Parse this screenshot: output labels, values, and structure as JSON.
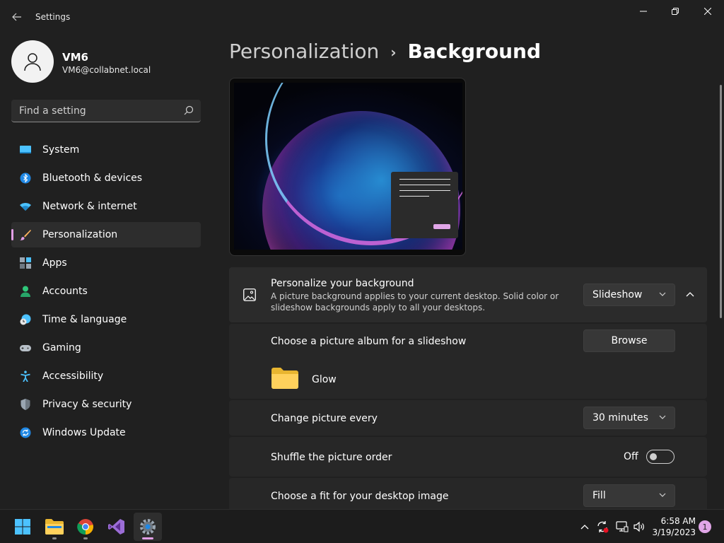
{
  "window": {
    "title": "Settings",
    "controls": {
      "minimize": "minimize-icon",
      "maximize": "restore-icon",
      "close": "close-icon"
    }
  },
  "profile": {
    "name": "VM6",
    "email": "VM6@collabnet.local"
  },
  "search": {
    "placeholder": "Find a setting"
  },
  "sidebar": {
    "items": [
      {
        "label": "System",
        "icon": "monitor-icon"
      },
      {
        "label": "Bluetooth & devices",
        "icon": "bluetooth-icon"
      },
      {
        "label": "Network & internet",
        "icon": "wifi-icon"
      },
      {
        "label": "Personalization",
        "icon": "brush-icon",
        "active": true
      },
      {
        "label": "Apps",
        "icon": "apps-icon"
      },
      {
        "label": "Accounts",
        "icon": "person-icon"
      },
      {
        "label": "Time & language",
        "icon": "clock-globe-icon"
      },
      {
        "label": "Gaming",
        "icon": "gamepad-icon"
      },
      {
        "label": "Accessibility",
        "icon": "accessibility-icon"
      },
      {
        "label": "Privacy & security",
        "icon": "shield-icon"
      },
      {
        "label": "Windows Update",
        "icon": "update-icon"
      }
    ]
  },
  "breadcrumb": {
    "parent": "Personalization",
    "separator": "›",
    "current": "Background"
  },
  "background": {
    "personalize": {
      "title": "Personalize your background",
      "description_line1": "A picture background applies to your current desktop. Solid color or",
      "description_line2": "slideshow backgrounds apply to all your desktops.",
      "value": "Slideshow"
    },
    "album": {
      "title": "Choose a picture album for a slideshow",
      "button": "Browse",
      "folder": "Glow"
    },
    "interval": {
      "title": "Change picture every",
      "value": "30 minutes"
    },
    "shuffle": {
      "title": "Shuffle the picture order",
      "state": "Off"
    },
    "fit": {
      "title": "Choose a fit for your desktop image",
      "value": "Fill"
    }
  },
  "taskbar": {
    "apps": [
      "start-icon",
      "file-explorer-icon",
      "chrome-icon",
      "visual-studio-icon",
      "settings-icon"
    ],
    "clock": {
      "time": "6:58 AM",
      "date": "3/19/2023"
    },
    "notifications": "1"
  },
  "colors": {
    "accent": "#e29ee6",
    "background": "#202020",
    "card": "#2b2b2b"
  }
}
